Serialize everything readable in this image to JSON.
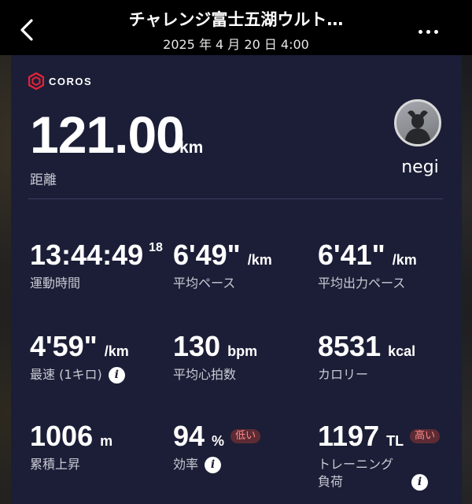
{
  "header": {
    "title": "チャレンジ富士五湖ウルト…",
    "subtitle": "2025 年 4 月 20 日 4:00"
  },
  "card": {
    "brand": "COROS",
    "distance": {
      "value": "121.00",
      "unit": "km",
      "label": "距離"
    },
    "user": {
      "name": "negi"
    },
    "stats": [
      {
        "value": "13:44:49",
        "unit": "18",
        "label": "運動時間"
      },
      {
        "value": "6'49\"",
        "unit": "/km",
        "label": "平均ペース"
      },
      {
        "value": "6'41\"",
        "unit": "/km",
        "label": "平均出力ペース"
      },
      {
        "value": "4'59\"",
        "unit": "/km",
        "label": "最速 (1キロ)",
        "info_icon": "i"
      },
      {
        "value": "130",
        "unit": "bpm",
        "label": "平均心拍数"
      },
      {
        "value": "8531",
        "unit": "kcal",
        "label": "カロリー"
      },
      {
        "value": "1006",
        "unit": "m",
        "label": "累積上昇"
      },
      {
        "value": "94",
        "unit": "%",
        "badge": "低い",
        "label": "効率",
        "info_icon": "i"
      },
      {
        "value": "1197",
        "unit": "TL",
        "badge": "高い",
        "label_line1": "トレーニング",
        "label_line2": "負荷",
        "info_icon": "i"
      }
    ]
  },
  "colors": {
    "card_bg": "#1b1e36",
    "brand_red": "#e2233a",
    "badge_bg": "#5d2b33",
    "badge_text": "#ff8a8a"
  },
  "icons": [
    "back-chevron-icon",
    "more-dots-icon",
    "coros-logo-icon",
    "info-icon"
  ]
}
